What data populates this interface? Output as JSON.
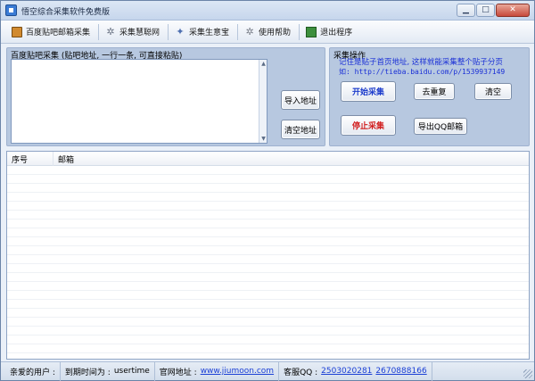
{
  "window": {
    "title": "悟空综合采集软件免费版"
  },
  "toolbar": {
    "items": [
      {
        "label": "百度贴吧邮箱采集",
        "icon": "book-icon"
      },
      {
        "label": "采集慧聪网",
        "icon": "gear-icon"
      },
      {
        "label": "采集生意宝",
        "icon": "star-icon"
      },
      {
        "label": "使用帮助",
        "icon": "help-icon"
      },
      {
        "label": "退出程序",
        "icon": "exit-icon"
      }
    ]
  },
  "left_group": {
    "title": "百度贴吧采集 (贴吧地址, 一行一条, 可直接粘贴)",
    "import_label": "导入地址",
    "clear_addr_label": "清空地址"
  },
  "right_group": {
    "title": "采集操作",
    "hint_line1": "记住是贴子首页地址, 这样就能采集整个贴子分页",
    "hint_line2": "如: http://tieba.baidu.com/p/1539937149",
    "start_label": "开始采集",
    "dedup_label": "去重复",
    "clear_label": "清空",
    "stop_label": "停止采集",
    "export_label": "导出QQ邮箱"
  },
  "list": {
    "col_seq": "序号",
    "col_email": "邮箱"
  },
  "status": {
    "user_label": "亲爱的用户 :",
    "expire_label": "到期时间为 :",
    "expire_value": "usertime",
    "site_label": "官网地址 :",
    "site_url": "www.jiumoon.com",
    "qq_label": "客服QQ :",
    "qq1": "2503020281",
    "qq2": "2670888166"
  },
  "colors": {
    "start_text": "#1a3acb",
    "stop_text": "#d11b1b",
    "hint_text": "#1a2fd6",
    "group_bg": "#b7c8e0"
  }
}
